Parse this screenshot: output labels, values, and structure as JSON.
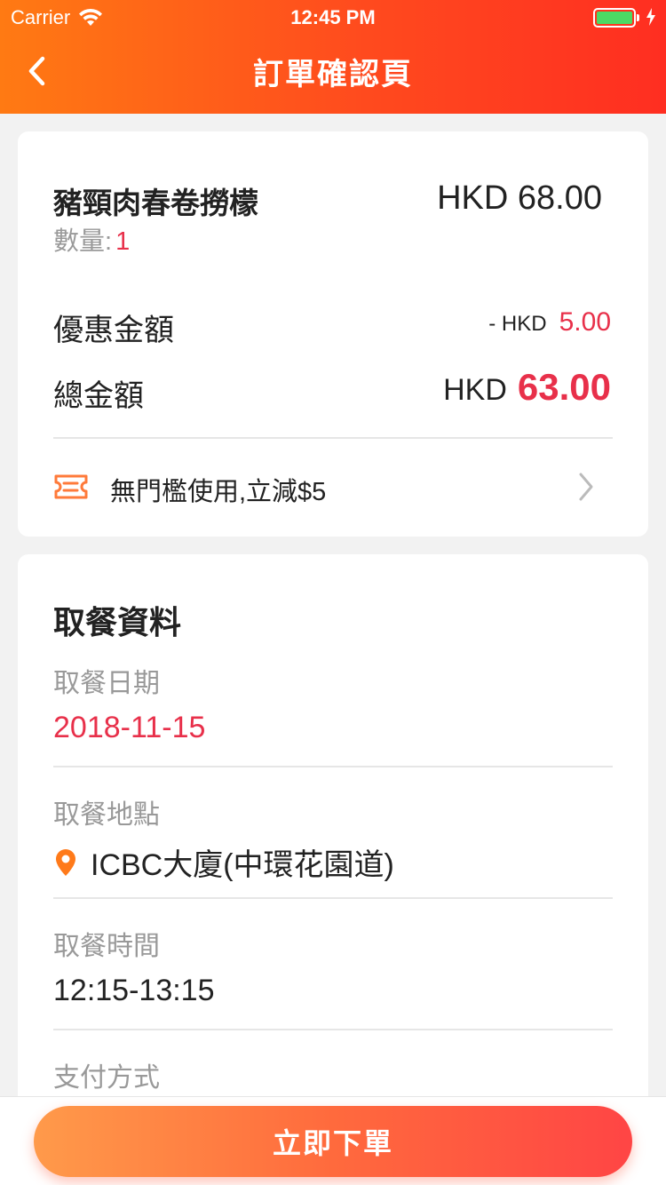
{
  "status_bar": {
    "carrier": "Carrier",
    "time": "12:45 PM"
  },
  "nav": {
    "title": "訂單確認頁",
    "back_icon": "chevron-left-icon"
  },
  "order": {
    "item_name": "豬頸肉春卷撈檬",
    "item_price": "HKD 68.00",
    "quantity_label": "數量:",
    "quantity_value": "1",
    "discount_label": "優惠金額",
    "discount_prefix": "- HKD",
    "discount_value": "5.00",
    "total_label": "總金額",
    "total_currency": "HKD",
    "total_value": "63.00",
    "coupon_text": "無門檻使用,立減$5"
  },
  "pickup": {
    "section_title": "取餐資料",
    "date_label": "取餐日期",
    "date_value": "2018-11-15",
    "location_label": "取餐地點",
    "location_value": "ICBC大廈(中環花園道)",
    "time_label": "取餐時間",
    "time_value": "12:15-13:15",
    "payment_label": "支付方式"
  },
  "footer": {
    "submit_label": "立即下單"
  },
  "colors": {
    "accent_red": "#e8304a",
    "header_start": "#ff7a13",
    "header_end": "#ff2e21",
    "battery_green": "#4cd964"
  }
}
